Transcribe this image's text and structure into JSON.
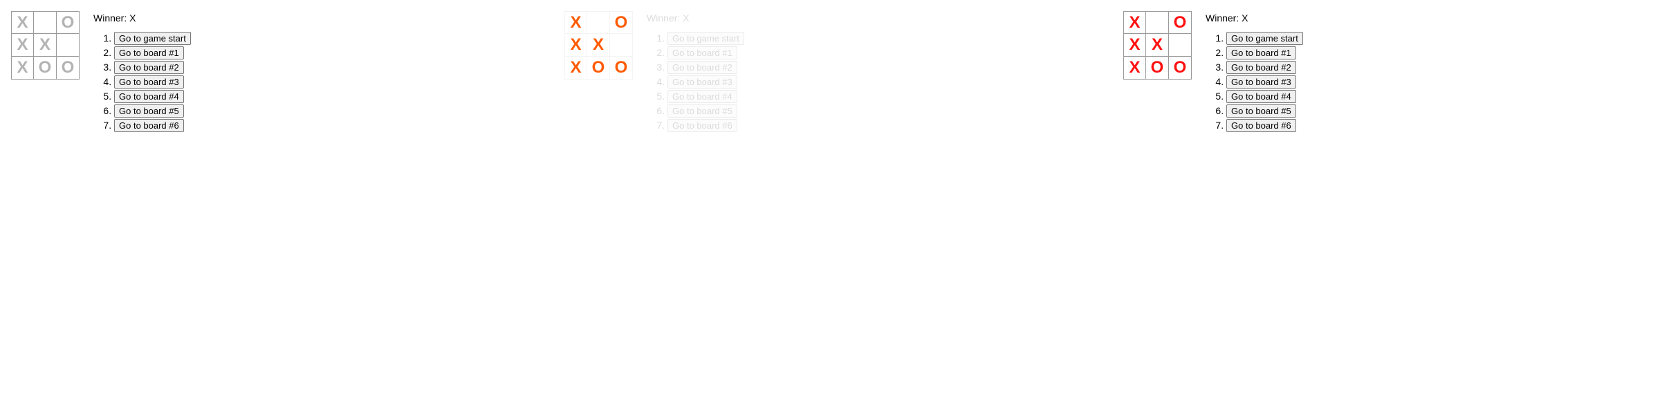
{
  "games": [
    {
      "board": [
        "X",
        "",
        "O",
        "X",
        "X",
        "",
        "X",
        "O",
        "O"
      ],
      "status": "Winner: X",
      "moves": [
        "Go to game start",
        "Go to board #1",
        "Go to board #2",
        "Go to board #3",
        "Go to board #4",
        "Go to board #5",
        "Go to board #6"
      ],
      "mark_color": "#b3b3b3"
    },
    {
      "board": [
        "X",
        "",
        "O",
        "X",
        "X",
        "",
        "X",
        "O",
        "O"
      ],
      "status": "Winner: X",
      "moves": [
        "Go to game start",
        "Go to board #1",
        "Go to board #2",
        "Go to board #3",
        "Go to board #4",
        "Go to board #5",
        "Go to board #6"
      ],
      "mark_color": "#ff5a00"
    },
    {
      "board": [
        "X",
        "",
        "O",
        "X",
        "X",
        "",
        "X",
        "O",
        "O"
      ],
      "status": "Winner: X",
      "moves": [
        "Go to game start",
        "Go to board #1",
        "Go to board #2",
        "Go to board #3",
        "Go to board #4",
        "Go to board #5",
        "Go to board #6"
      ],
      "mark_color": "#ff1010"
    }
  ]
}
